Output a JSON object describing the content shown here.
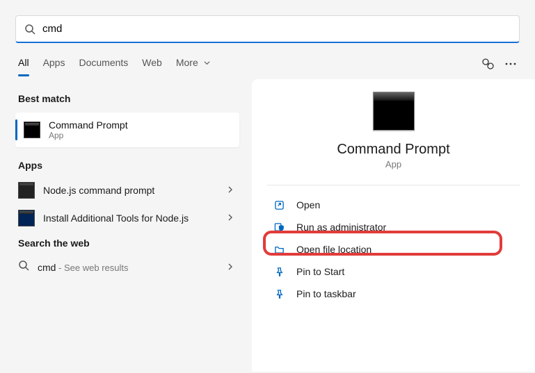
{
  "search": {
    "value": "cmd"
  },
  "tabs": {
    "all": "All",
    "apps": "Apps",
    "documents": "Documents",
    "web": "Web",
    "more": "More"
  },
  "sections": {
    "best_match": "Best match",
    "apps": "Apps",
    "search_web": "Search the web"
  },
  "best_match": {
    "title": "Command Prompt",
    "subtitle": "App"
  },
  "apps_list": [
    {
      "label": "Node.js command prompt"
    },
    {
      "label": "Install Additional Tools for Node.js"
    }
  ],
  "web_item": {
    "term": "cmd",
    "suffix": " - See web results"
  },
  "preview": {
    "title": "Command Prompt",
    "subtitle": "App"
  },
  "actions": {
    "open": "Open",
    "run_admin": "Run as administrator",
    "open_loc": "Open file location",
    "pin_start": "Pin to Start",
    "pin_taskbar": "Pin to taskbar"
  }
}
